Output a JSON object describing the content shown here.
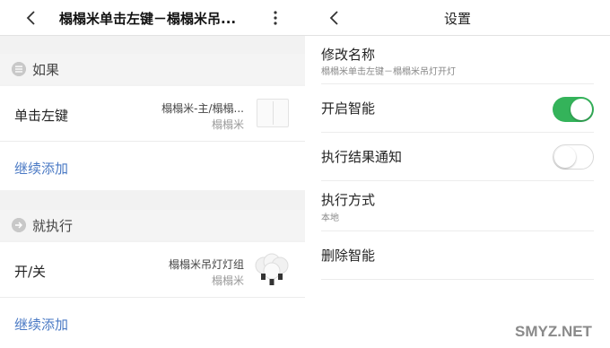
{
  "left": {
    "header": {
      "title": "榻榻米单击左键－榻榻米吊..."
    },
    "if_section": {
      "label": "如果"
    },
    "trigger_row": {
      "label": "单击左键",
      "device_name": "榻榻米-主/榻榻...",
      "device_room": "榻榻米"
    },
    "add_trigger": {
      "label": "继续添加"
    },
    "then_section": {
      "label": "就执行"
    },
    "action_row": {
      "label": "开/关",
      "device_name": "榻榻米吊灯灯组",
      "device_room": "榻榻米"
    },
    "add_action": {
      "label": "继续添加"
    }
  },
  "right": {
    "header": {
      "title": "设置"
    },
    "rename": {
      "label": "修改名称",
      "value": "榻榻米单击左键－榻榻米吊灯开灯"
    },
    "enable": {
      "label": "开启智能",
      "state": "on"
    },
    "notify": {
      "label": "执行结果通知",
      "state": "off"
    },
    "mode": {
      "label": "执行方式",
      "value": "本地"
    },
    "delete": {
      "label": "删除智能"
    }
  },
  "watermark": {
    "text": "SMYZ.NET"
  },
  "colors": {
    "accent_green": "#34b35a",
    "link_blue": "#4a79c4"
  }
}
